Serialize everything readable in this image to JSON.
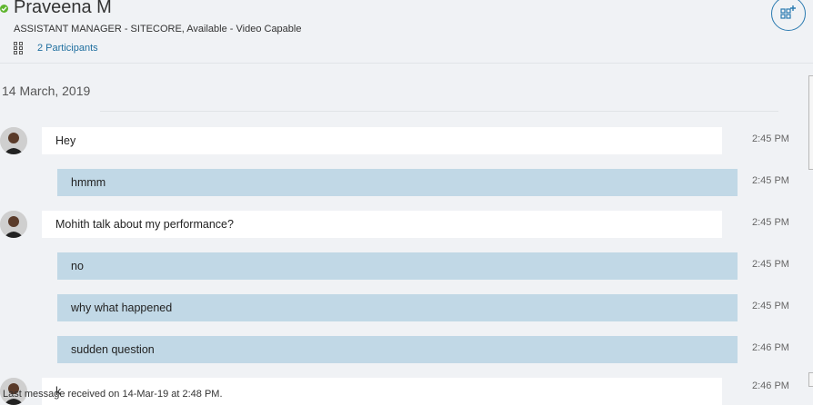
{
  "header": {
    "name": "Praveena M",
    "subtitle": "ASSISTANT MANAGER - SITECORE,  Available - Video Capable",
    "participants": "2 Participants",
    "add_icon": "add-participant-icon"
  },
  "conversation": {
    "date": "14 March, 2019",
    "messages": [
      {
        "text": "Hey",
        "time": "2:45 PM",
        "direction": "in"
      },
      {
        "text": "hmmm",
        "time": "2:45 PM",
        "direction": "out"
      },
      {
        "text": "Mohith talk about my performance?",
        "time": "2:45 PM",
        "direction": "in"
      },
      {
        "text": "no",
        "time": "2:45 PM",
        "direction": "out"
      },
      {
        "text": "why what happened",
        "time": "2:45 PM",
        "direction": "out"
      },
      {
        "text": "sudden question",
        "time": "2:46 PM",
        "direction": "out"
      },
      {
        "text": "k",
        "time": "2:46 PM",
        "direction": "in"
      }
    ]
  },
  "footer": {
    "last_message": "Last message received on 14-Mar-19 at 2:48 PM."
  },
  "colors": {
    "incoming_bubble": "#ffffff",
    "outgoing_bubble": "#c1d8e6",
    "link": "#1f6f9f",
    "presence": "#5fb52f"
  }
}
